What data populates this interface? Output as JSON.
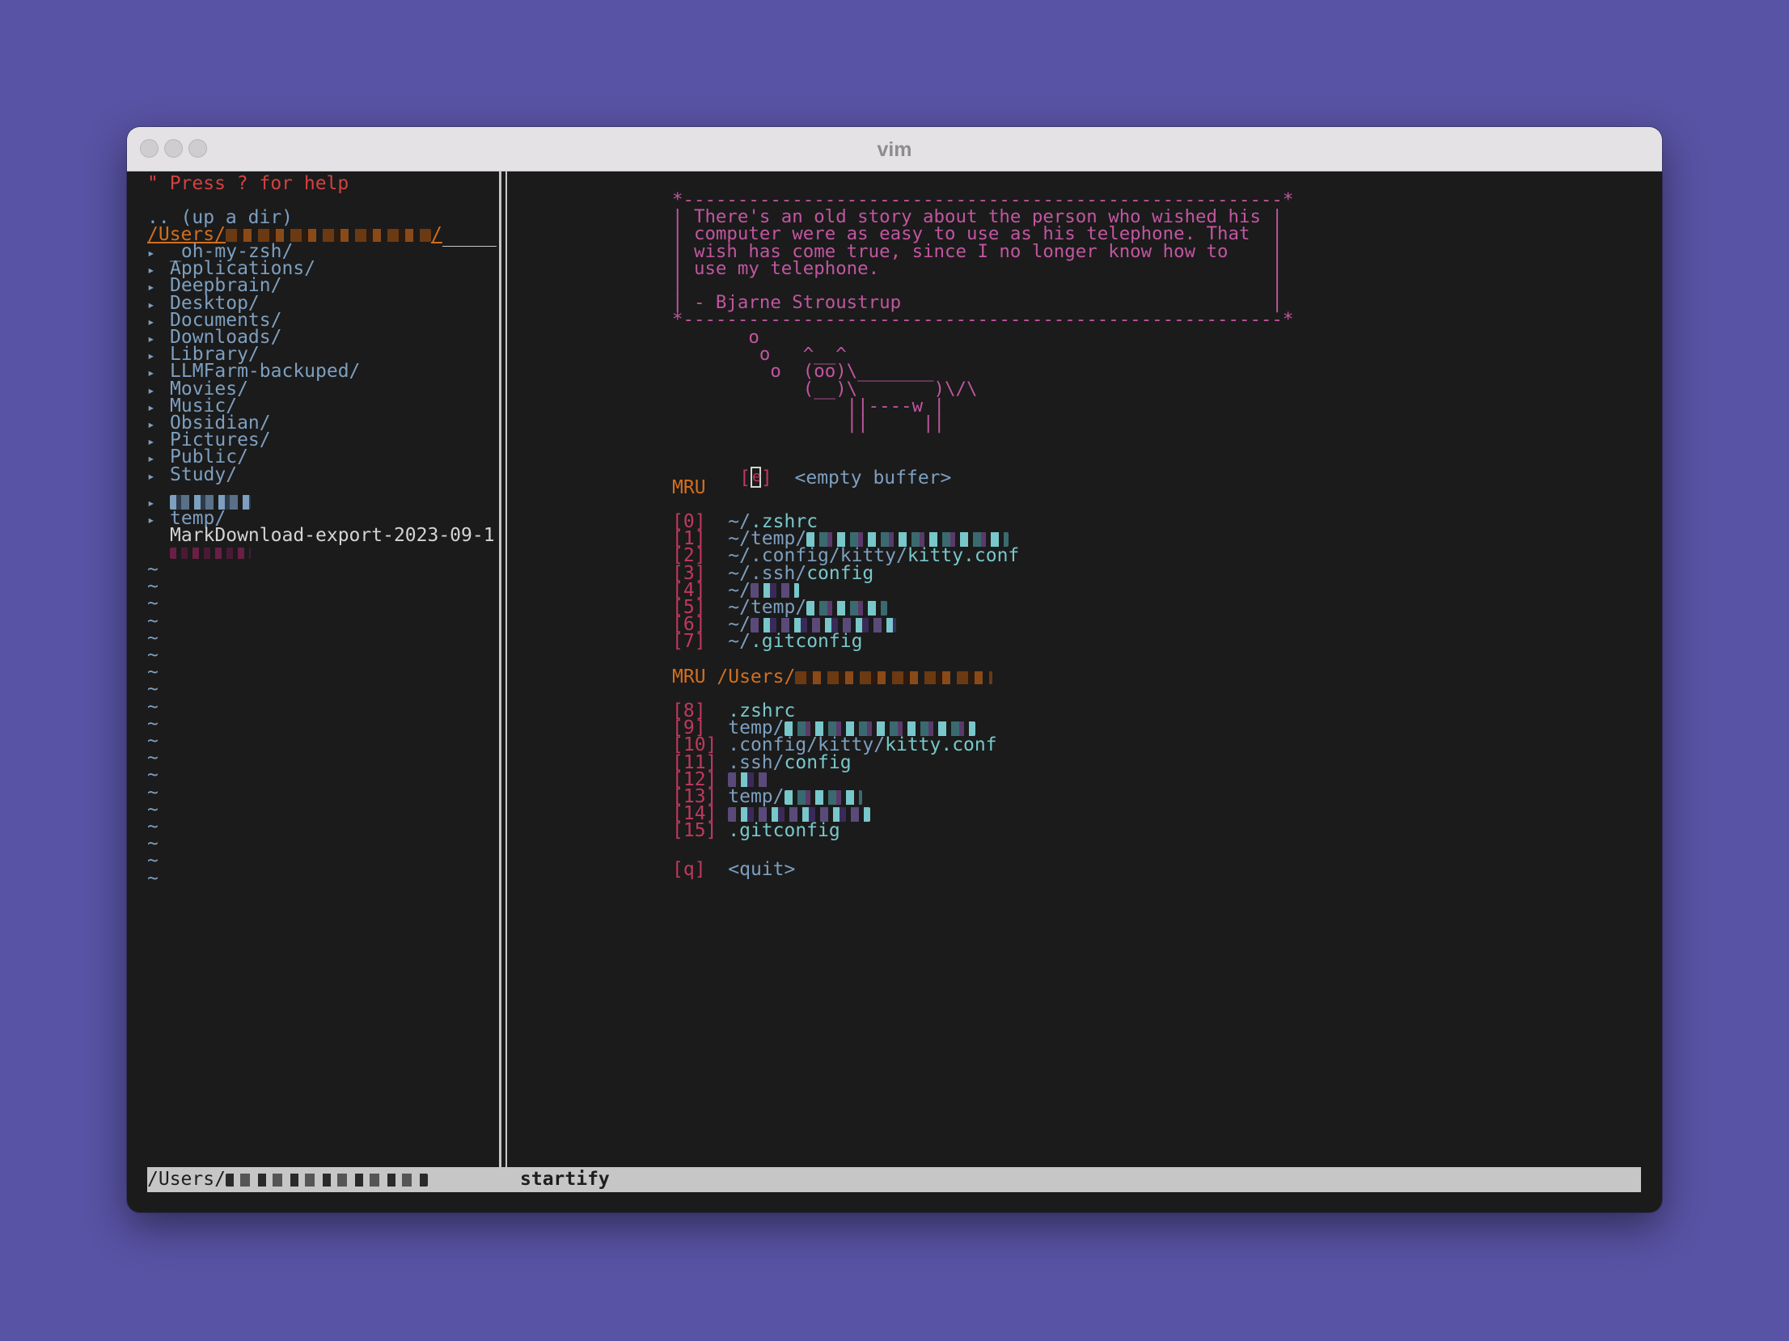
{
  "window": {
    "title": "vim"
  },
  "nerdtree": {
    "help": "\" Press ? for help",
    "up_dir": ".. (up a dir)",
    "root_prefix": "/Users/",
    "root_suffix": "/",
    "arrow": "▸",
    "dirs": [
      "_oh-my-zsh/",
      "Applications/",
      "Deepbrain/",
      "Desktop/",
      "Documents/",
      "Downloads/",
      "Library/",
      "LLMFarm-backuped/",
      "Movies/",
      "Music/",
      "Obsidian/",
      "Pictures/",
      "Public/",
      "Study/"
    ],
    "temp_dir": "temp/",
    "file": "MarkDownload-export-2023-09-1",
    "empty_marker": "~"
  },
  "startify": {
    "quote_lines": [
      "*-------------------------------------------------------*",
      "| There's an old story about the person who wished his |",
      "| computer were as easy to use as his telephone. That  |",
      "| wish has come true, since I no longer know how to    |",
      "| use my telephone.                                    |",
      "|                                                      |",
      "| - Bjarne Stroustrup                                  |",
      "*-------------------------------------------------------*"
    ],
    "cow_lines": [
      "       o",
      "        o   ^__^",
      "         o  (oo)\\_______",
      "            (__)\\       )\\/\\",
      "                ||----w |",
      "                ||     ||"
    ],
    "empty_buffer": {
      "key": "e",
      "label": "<empty buffer>"
    },
    "mru_header": "MRU",
    "mru_items": [
      {
        "idx": "[0]",
        "dir": "~/",
        "file": ".zshrc"
      },
      {
        "idx": "[1]",
        "dir": "~/temp/",
        "file": ""
      },
      {
        "idx": "[2]",
        "dir": "~/.config/kitty/",
        "file": "kitty.conf"
      },
      {
        "idx": "[3]",
        "dir": "~/.ssh/",
        "file": "config"
      },
      {
        "idx": "[4]",
        "dir": "~/",
        "file": ""
      },
      {
        "idx": "[5]",
        "dir": "~/temp/",
        "file": ""
      },
      {
        "idx": "[6]",
        "dir": "~/",
        "file": ""
      },
      {
        "idx": "[7]",
        "dir": "~/",
        "file": ".gitconfig"
      }
    ],
    "mru_dir_header_prefix": "MRU /Users/",
    "mru_dir_items": [
      {
        "idx": "[8]",
        "dir": "",
        "file": ".zshrc"
      },
      {
        "idx": "[9]",
        "dir": "temp/",
        "file": ""
      },
      {
        "idx": "[10]",
        "dir": ".config/kitty/",
        "file": "kitty.conf"
      },
      {
        "idx": "[11]",
        "dir": ".ssh/",
        "file": "config"
      },
      {
        "idx": "[12]",
        "dir": "",
        "file": ""
      },
      {
        "idx": "[13]",
        "dir": "temp/",
        "file": ""
      },
      {
        "idx": "[14]",
        "dir": "",
        "file": ""
      },
      {
        "idx": "[15]",
        "dir": "",
        "file": ".gitconfig"
      }
    ],
    "quit": {
      "key": "[q]",
      "label": "<quit>"
    }
  },
  "statusline": {
    "left_prefix": "/Users/",
    "right": "startify"
  },
  "colors": {
    "background": "#5853a4",
    "editor": "#1b1b1b",
    "quote": "#c156a0",
    "header": "#d36f1e",
    "index": "#c0395f",
    "path": "#7d9fc0",
    "file": "#78c7ca"
  }
}
